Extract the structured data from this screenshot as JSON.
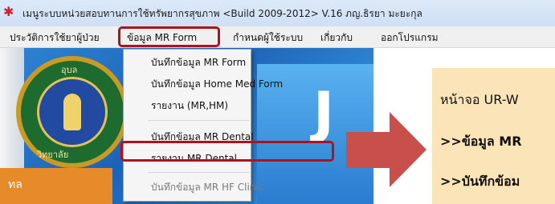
{
  "window": {
    "title": "เมนูระบบหน่วยสอบทานการใช้ทรัพยากรสุขภาพ <Build 2009-2012> V.16 ภญ.ธิรยา มะยะกุล"
  },
  "menubar": {
    "items": [
      {
        "label": "ประวัติการใช้ยาผู้ป่วย"
      },
      {
        "label": "ข้อมูล MR Form"
      },
      {
        "label": "กำหนดผู้ใช้ระบบ"
      },
      {
        "label": "เกี่ยวกับ"
      },
      {
        "label": "ออกโปรแกรม"
      }
    ]
  },
  "dropdown": {
    "items": [
      {
        "label": "บันทึกข้อมูล MR Form"
      },
      {
        "label": "บันทึกข้อมูล Home Med Form"
      },
      {
        "label": "รายงาน (MR,HM)"
      },
      {
        "label": "บันทึกข้อมูล MR Dental"
      },
      {
        "label": "รายงาน MR Dental"
      },
      {
        "label": "บันทึกข้อมูล MR HF Clinic"
      }
    ]
  },
  "logo": {
    "text_top": "อุบล",
    "text_left": "วิทยาลัย",
    "text_band": "ทล"
  },
  "callout": {
    "line1": "หน้าจอ UR-W",
    "line2": ">>ข้อมูล MR",
    "line3": ">>บันทึกข้อม"
  },
  "colors": {
    "highlight_border": "#b0121b",
    "arrow": "#c9504a",
    "callout_bg": "#fbe4b8"
  }
}
